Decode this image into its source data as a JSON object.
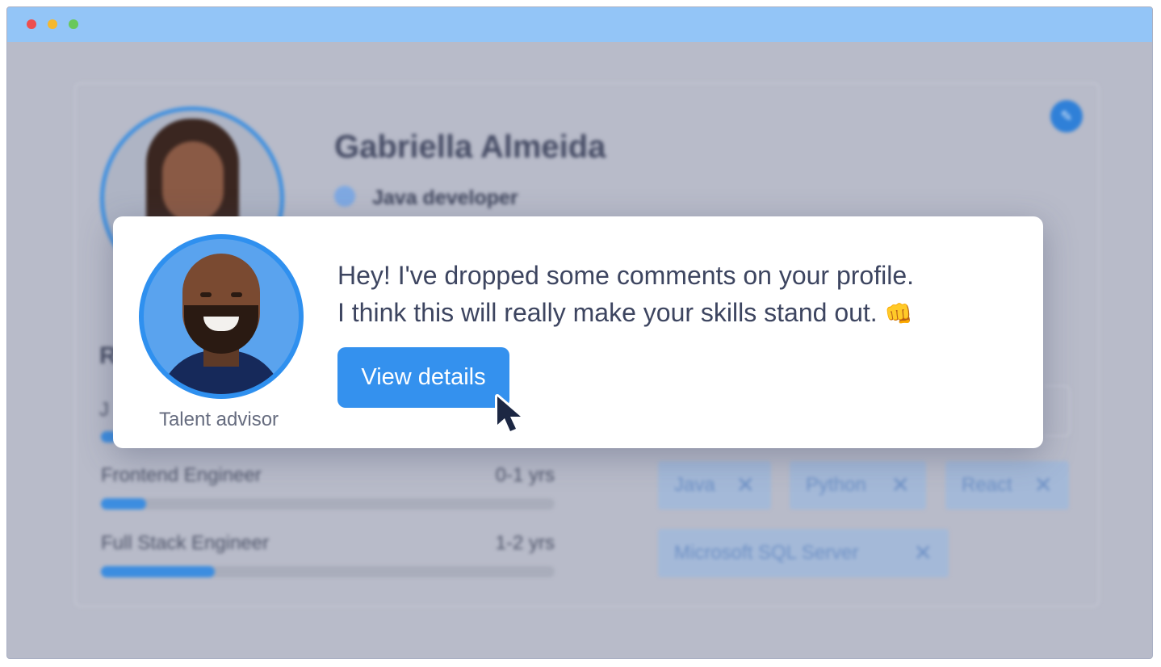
{
  "window": {
    "controls": [
      "close",
      "minimize",
      "maximize"
    ]
  },
  "profile": {
    "name": "Gabriella Almeida",
    "role": "Java developer",
    "section_initial": "R",
    "partial_row_initial": "J",
    "edit_icon": "pencil-icon",
    "experience": [
      {
        "title": "Frontend Engineer",
        "years": "0-1 yrs",
        "progress": 0.1
      },
      {
        "title": "Full Stack Engineer",
        "years": "1-2 yrs",
        "progress": 0.25
      }
    ],
    "skills": [
      "Java",
      "Python",
      "React",
      "Microsoft SQL Server"
    ]
  },
  "notification": {
    "message_line1": "Hey! I've dropped some comments on your profile.",
    "message_line2": "I think this will really make your skills stand out.",
    "emoji": "👊",
    "button_label": "View details",
    "advisor_label": "Talent advisor"
  },
  "colors": {
    "accent": "#3491ee",
    "titlebar": "#93c5f7",
    "text": "#3d4560"
  }
}
